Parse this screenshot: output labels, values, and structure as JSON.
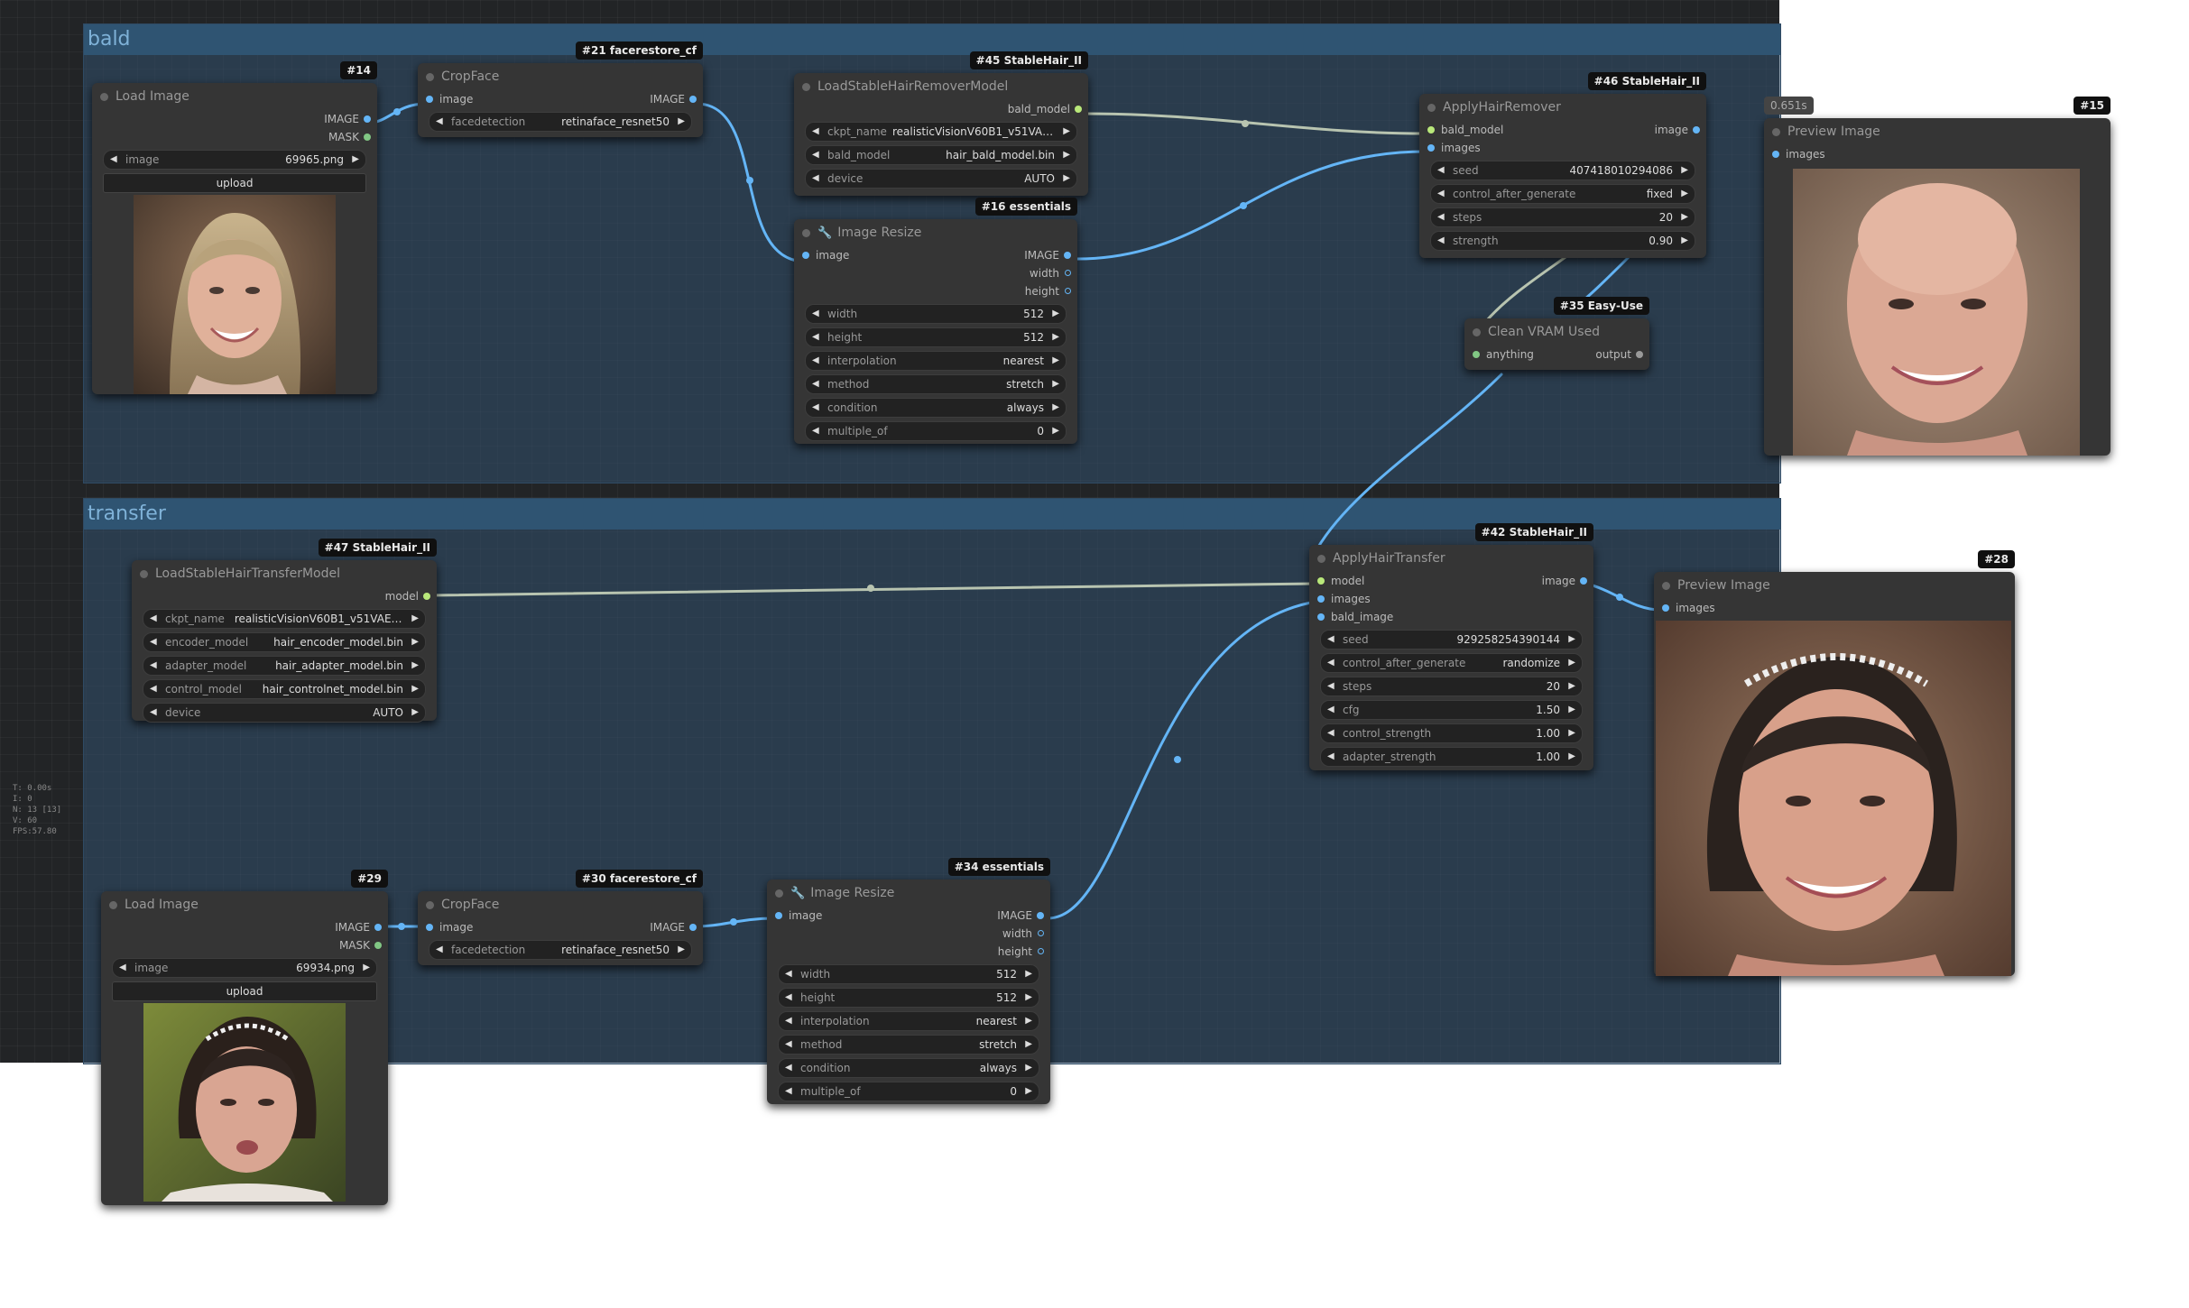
{
  "groups": {
    "bald": "bald",
    "transfer": "transfer"
  },
  "nodes": {
    "n14": {
      "badge": "#14",
      "title": "Load Image",
      "outputs": [
        "IMAGE",
        "MASK"
      ],
      "image": "69965.png",
      "upload": "upload"
    },
    "n21": {
      "badge": "#21 facerestore_cf",
      "title": "CropFace",
      "input": "image",
      "output": "IMAGE",
      "w_name": "facedetection",
      "w_value": "retinaface_resnet50"
    },
    "n45": {
      "badge": "#45 StableHair_II",
      "title": "LoadStableHairRemoverModel",
      "output": "bald_model",
      "widgets": [
        {
          "name": "ckpt_name",
          "value": "realisticVisionV60B1_v51VAE...."
        },
        {
          "name": "bald_model",
          "value": "hair_bald_model.bin"
        },
        {
          "name": "device",
          "value": "AUTO"
        }
      ]
    },
    "n16": {
      "badge": "#16 essentials",
      "title": "Image Resize",
      "input": "image",
      "outputs": [
        "IMAGE",
        "width",
        "height"
      ],
      "widgets": [
        {
          "name": "width",
          "value": "512"
        },
        {
          "name": "height",
          "value": "512"
        },
        {
          "name": "interpolation",
          "value": "nearest"
        },
        {
          "name": "method",
          "value": "stretch"
        },
        {
          "name": "condition",
          "value": "always"
        },
        {
          "name": "multiple_of",
          "value": "0"
        }
      ]
    },
    "n46": {
      "badge": "#46 StableHair_II",
      "title": "ApplyHairRemover",
      "inputs": [
        "bald_model",
        "images"
      ],
      "output": "image",
      "widgets": [
        {
          "name": "seed",
          "value": "407418010294086"
        },
        {
          "name": "control_after_generate",
          "value": "fixed"
        },
        {
          "name": "steps",
          "value": "20"
        },
        {
          "name": "strength",
          "value": "0.90"
        }
      ]
    },
    "n35": {
      "badge": "#35 Easy-Use",
      "title": "Clean VRAM Used",
      "input": "anything",
      "output": "output"
    },
    "n15": {
      "badge": "#15",
      "time": "0.651s",
      "title": "Preview Image",
      "input": "images"
    },
    "n47": {
      "badge": "#47 StableHair_II",
      "title": "LoadStableHairTransferModel",
      "output": "model",
      "widgets": [
        {
          "name": "ckpt_name",
          "value": "realisticVisionV60B1_v51VAE.saf..."
        },
        {
          "name": "encoder_model",
          "value": "hair_encoder_model.bin"
        },
        {
          "name": "adapter_model",
          "value": "hair_adapter_model.bin"
        },
        {
          "name": "control_model",
          "value": "hair_controlnet_model.bin"
        },
        {
          "name": "device",
          "value": "AUTO"
        }
      ]
    },
    "n42": {
      "badge": "#42 StableHair_II",
      "title": "ApplyHairTransfer",
      "inputs": [
        "model",
        "images",
        "bald_image"
      ],
      "output": "image",
      "widgets": [
        {
          "name": "seed",
          "value": "929258254390144"
        },
        {
          "name": "control_after_generate",
          "value": "randomize"
        },
        {
          "name": "steps",
          "value": "20"
        },
        {
          "name": "cfg",
          "value": "1.50"
        },
        {
          "name": "control_strength",
          "value": "1.00"
        },
        {
          "name": "adapter_strength",
          "value": "1.00"
        }
      ]
    },
    "n28": {
      "badge": "#28",
      "title": "Preview Image",
      "input": "images"
    },
    "n29": {
      "badge": "#29",
      "title": "Load Image",
      "outputs": [
        "IMAGE",
        "MASK"
      ],
      "image": "69934.png",
      "upload": "upload"
    },
    "n30": {
      "badge": "#30 facerestore_cf",
      "title": "CropFace",
      "input": "image",
      "output": "IMAGE",
      "w_name": "facedetection",
      "w_value": "retinaface_resnet50"
    },
    "n34": {
      "badge": "#34 essentials",
      "title": "Image Resize",
      "input": "image",
      "outputs": [
        "IMAGE",
        "width",
        "height"
      ],
      "widgets": [
        {
          "name": "width",
          "value": "512"
        },
        {
          "name": "height",
          "value": "512"
        },
        {
          "name": "interpolation",
          "value": "nearest"
        },
        {
          "name": "method",
          "value": "stretch"
        },
        {
          "name": "condition",
          "value": "always"
        },
        {
          "name": "multiple_of",
          "value": "0"
        }
      ]
    }
  },
  "stats": [
    "T: 0.00s",
    "I: 0",
    "N: 13 [13]",
    "V: 60",
    "FPS:57.80"
  ],
  "colors": {
    "canvas": "#222426",
    "group_fill": "#32506e",
    "group_title": "#2f5472",
    "node": "#353535",
    "image_link": "#64b5f6",
    "model_link": "#b8c4b0"
  },
  "icons": {
    "widget_left": "◀",
    "widget_right": "▶",
    "node_icon": "wrench-icon"
  }
}
